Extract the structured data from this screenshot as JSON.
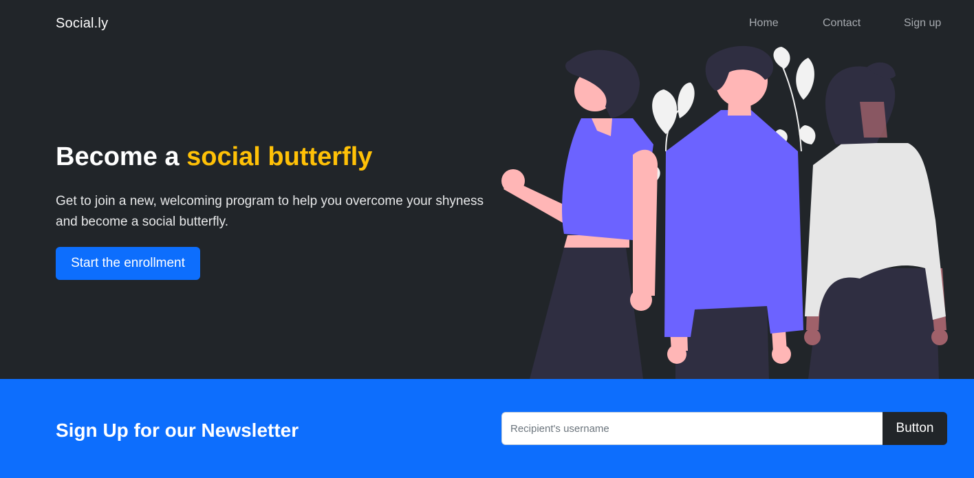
{
  "navbar": {
    "brand": "Social.ly",
    "links": [
      {
        "label": "Home"
      },
      {
        "label": "Contact"
      },
      {
        "label": "Sign up"
      }
    ]
  },
  "hero": {
    "title_prefix": "Become a ",
    "title_accent": "social butterfly",
    "lead": "Get to join a new, welcoming program to help you overcome your shyness and become a social butterfly.",
    "cta_label": "Start the enrollment",
    "illustration_icon": "people-group-illustration"
  },
  "newsletter": {
    "title": "Sign Up for our Newsletter",
    "input_placeholder": "Recipient's username",
    "input_value": "",
    "button_label": "Button"
  },
  "colors": {
    "background_dark": "#212529",
    "accent_yellow": "#ffc107",
    "primary_blue": "#0d6efd",
    "illustration_purple": "#6c63ff",
    "illustration_skin": "#ffb6b6",
    "illustration_dark": "#2f2e41",
    "illustration_light": "#e6e6e6"
  }
}
